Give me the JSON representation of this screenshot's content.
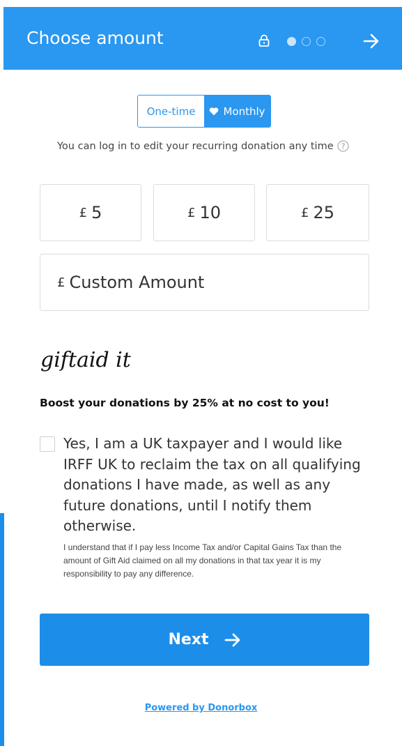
{
  "header": {
    "title": "Choose amount",
    "bg_color": "#2a97f0",
    "lock_icon": "lock-icon",
    "steps": {
      "total": 3,
      "current": 1
    },
    "next_icon": "arrow-right-icon"
  },
  "frequency": {
    "options": [
      {
        "label": "One-time",
        "selected": false
      },
      {
        "label": "Monthly",
        "selected": true,
        "icon": "heart-icon"
      }
    ]
  },
  "recurring_note": "You can log in to edit your recurring donation any time",
  "amounts": {
    "currency": "£",
    "presets": [
      "5",
      "10",
      "25"
    ],
    "custom_placeholder": "Custom Amount"
  },
  "gift_aid": {
    "logo_text": "giftaid it",
    "headline": "Boost your donations by 25% at no cost to you!",
    "consent": "Yes, I am a UK taxpayer and I would like IRFF UK to reclaim the tax on all qualifying donations I have made, as well as any future donations, until I notify them otherwise.",
    "checked": false,
    "fine_print": "I understand that if I pay less Income Tax and/or Capital Gains Tax than the amount of Gift Aid claimed on all my donations in that tax year it is my responsibility to pay any difference."
  },
  "next_button": {
    "label": "Next",
    "color": "#1c8ee9"
  },
  "footer": {
    "powered_by": "Powered by Donorbox"
  }
}
